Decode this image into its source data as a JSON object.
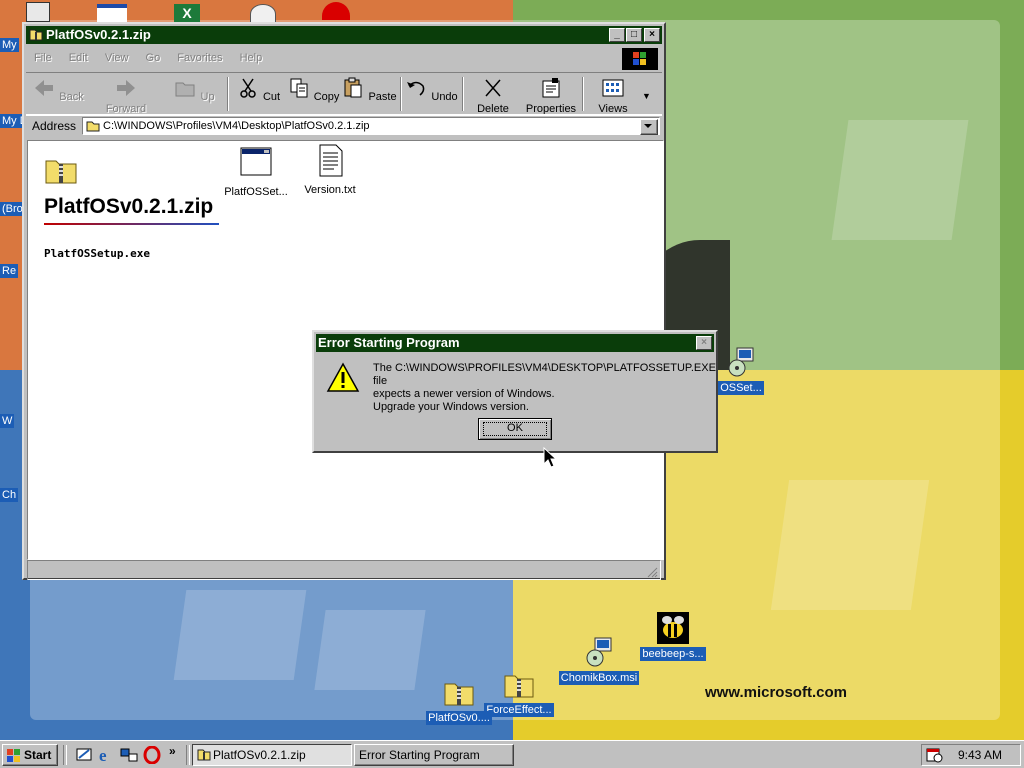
{
  "desktop": {
    "url_text": "www.microsoft.com",
    "icons": [
      {
        "label": "OSSet...",
        "icon": "installer-icon"
      },
      {
        "label": "beebeep-s...",
        "icon": "bee-icon"
      },
      {
        "label": "ChomikBox.msi",
        "icon": "installer-icon"
      },
      {
        "label": "ForceEffect...",
        "icon": "zip-folder-icon"
      },
      {
        "label": "PlatfOSv0....",
        "icon": "zip-folder-icon"
      }
    ],
    "left_labels": [
      "My",
      "My D",
      "(Bro",
      "Re",
      "W",
      "Ch"
    ],
    "colors": {
      "orange": "#d9773f",
      "green": "#7cac56",
      "blue": "#3f76b9",
      "yellow": "#e5cc2b"
    }
  },
  "explorer": {
    "title": "PlatfOSv0.2.1.zip",
    "menu": [
      "File",
      "Edit",
      "View",
      "Go",
      "Favorites",
      "Help"
    ],
    "toolbar": [
      {
        "label": "Back",
        "icon": "back-arrow-icon",
        "enabled": false
      },
      {
        "label": "Forward",
        "icon": "forward-arrow-icon",
        "enabled": false
      },
      {
        "label": "Up",
        "icon": "up-folder-icon",
        "enabled": false
      },
      {
        "label": "Cut",
        "icon": "scissors-icon",
        "enabled": true
      },
      {
        "label": "Copy",
        "icon": "copy-icon",
        "enabled": true
      },
      {
        "label": "Paste",
        "icon": "paste-icon",
        "enabled": true
      },
      {
        "label": "Undo",
        "icon": "undo-icon",
        "enabled": true
      },
      {
        "label": "Delete",
        "icon": "delete-x-icon",
        "enabled": true
      },
      {
        "label": "Properties",
        "icon": "properties-icon",
        "enabled": true
      },
      {
        "label": "Views",
        "icon": "views-icon",
        "enabled": true
      }
    ],
    "address_label": "Address",
    "address_value": "C:\\WINDOWS\\Profiles\\VM4\\Desktop\\PlatfOSv0.2.1.zip",
    "panel_title": "PlatfOSv0.2.1.zip",
    "panel_selected": "PlatfOSSetup.exe",
    "files": [
      {
        "label": "PlatfOSSet...",
        "icon": "exe-window-icon"
      },
      {
        "label": "Version.txt",
        "icon": "text-file-icon"
      }
    ]
  },
  "dialog": {
    "title": "Error Starting Program",
    "line1": "The C:\\WINDOWS\\PROFILES\\VM4\\DESKTOP\\PLATFOSSETUP.EXE file",
    "line2": "expects a newer version of Windows.",
    "line3": "Upgrade your Windows version.",
    "ok_label": "OK"
  },
  "taskbar": {
    "start_label": "Start",
    "tasks": [
      {
        "label": "PlatfOSv0.2.1.zip",
        "active": true
      },
      {
        "label": "Error Starting Program",
        "active": false
      }
    ],
    "quicklaunch_more": "»",
    "clock": "9:43 AM"
  }
}
